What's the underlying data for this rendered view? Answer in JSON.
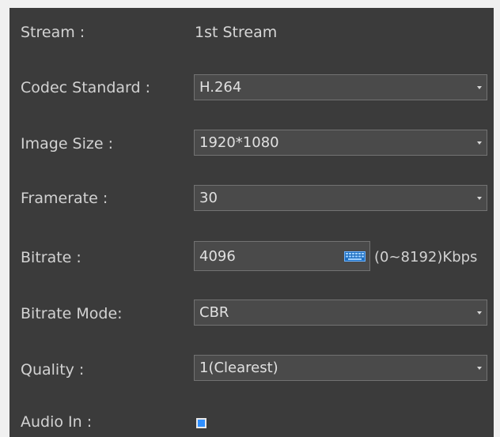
{
  "form": {
    "stream": {
      "label": "Stream :",
      "value": "1st Stream"
    },
    "codec_standard": {
      "label": "Codec Standard :",
      "value": "H.264"
    },
    "image_size": {
      "label": "Image Size :",
      "value": "1920*1080"
    },
    "framerate": {
      "label": "Framerate :",
      "value": "30"
    },
    "bitrate": {
      "label": "Bitrate :",
      "value": "4096",
      "range": "(0~8192)Kbps",
      "icon": "keyboard-icon"
    },
    "bitrate_mode": {
      "label": "Bitrate Mode:",
      "value": "CBR"
    },
    "quality": {
      "label": "Quality :",
      "value": "1(Clearest)"
    },
    "audio_in": {
      "label": "Audio In :",
      "checked": true
    }
  },
  "colors": {
    "panel_bg": "#3b3b3b",
    "field_bg": "#4a4a4a",
    "field_border": "#727272",
    "accent": "#2f8fff"
  }
}
